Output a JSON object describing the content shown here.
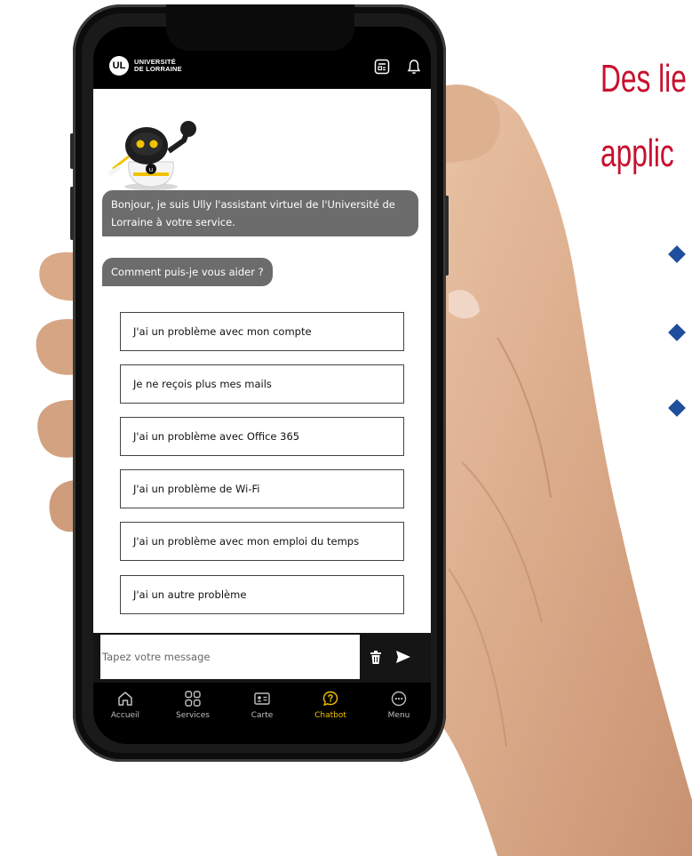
{
  "slide": {
    "title_line1": "Des lie",
    "title_line2": "applic",
    "title_color": "#c8102e",
    "bullet_color": "#1f4e9c"
  },
  "app": {
    "logo_mark": "UL",
    "logo_line1": "UNIVERSITÉ",
    "logo_line2": "DE LORRAINE",
    "header_icons": [
      "news-icon",
      "bell-icon"
    ]
  },
  "chat": {
    "mascot": "ully-robot-mascot",
    "messages": [
      "Bonjour, je suis Ully l'assistant virtuel de l'Université de Lorraine à votre service.",
      "Comment puis-je vous aider ?"
    ],
    "options": [
      "J'ai un problème avec mon compte",
      "Je ne reçois plus mes mails",
      "J'ai un problème avec Office 365",
      "J'ai un problème de Wi-Fi",
      "J'ai un problème avec mon emploi du temps",
      "J'ai un autre problème"
    ],
    "bubble_color": "#6c6c6c"
  },
  "input": {
    "placeholder": "Tapez votre message",
    "delete_icon": "trash-icon",
    "send_icon": "send-icon"
  },
  "tabs": [
    {
      "label": "Accueil",
      "icon": "home-icon",
      "active": false
    },
    {
      "label": "Services",
      "icon": "grid-icon",
      "active": false
    },
    {
      "label": "Carte",
      "icon": "id-card-icon",
      "active": false
    },
    {
      "label": "Chatbot",
      "icon": "chat-help-icon",
      "active": true
    },
    {
      "label": "Menu",
      "icon": "more-icon",
      "active": false
    }
  ],
  "accent_color": "#f2c200"
}
